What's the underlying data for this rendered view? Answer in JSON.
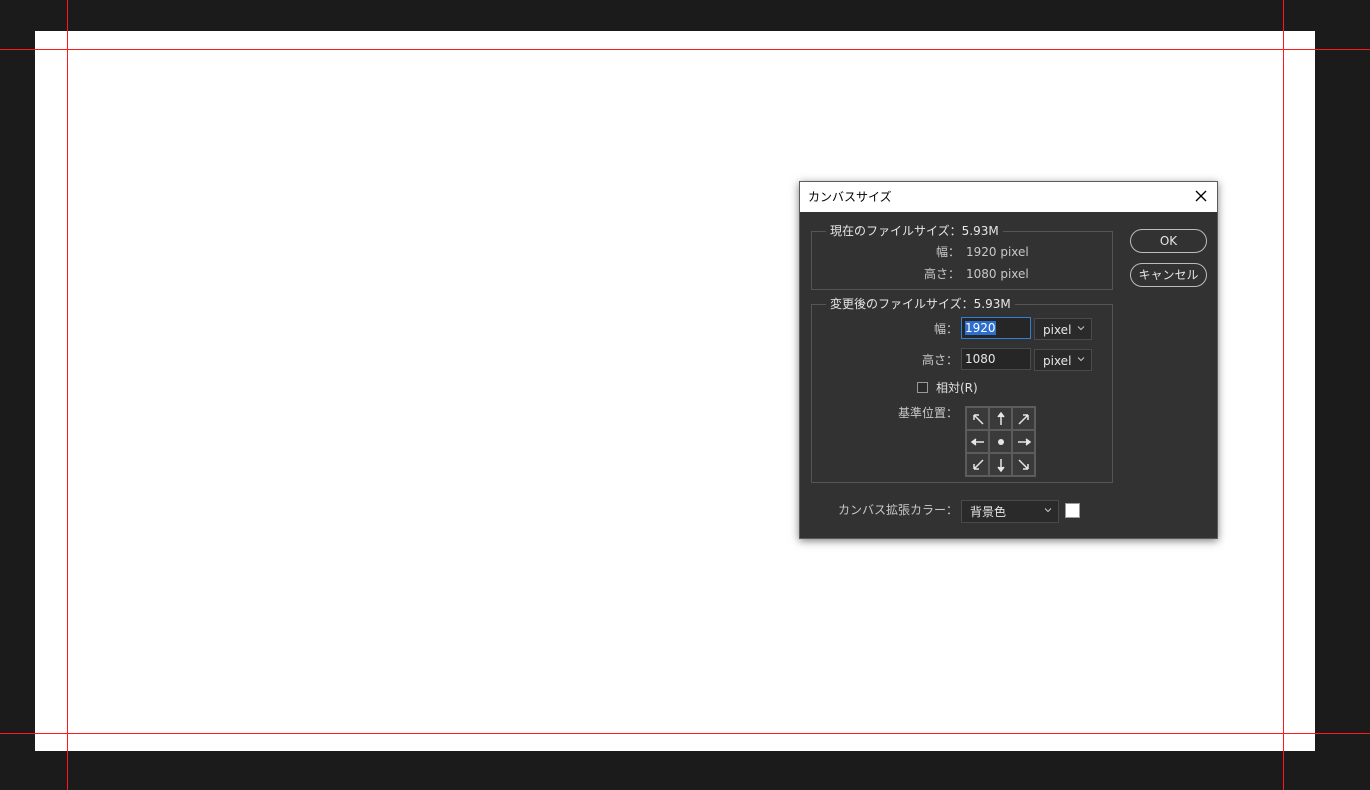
{
  "colors": {
    "workspace_bg": "#1b1b1b",
    "canvas_bg": "#ffffff",
    "guide": "#ff1a1a",
    "dialog_bg": "#323232",
    "selection": "#2d6fd1",
    "extension_swatch": "#ffffff"
  },
  "dialog": {
    "title": "カンバスサイズ",
    "close_icon": "close-icon",
    "current": {
      "legend": "現在のファイルサイズ：5.93M",
      "width_label": "幅：",
      "width_value": "1920 pixel",
      "height_label": "高さ：",
      "height_value": "1080 pixel"
    },
    "new": {
      "legend": "変更後のファイルサイズ：5.93M",
      "width_label": "幅：",
      "width_value": "1920",
      "width_unit": "pixel",
      "height_label": "高さ：",
      "height_value": "1080",
      "height_unit": "pixel",
      "relative_label": "相対(R)",
      "relative_checked": false,
      "anchor_label": "基準位置："
    },
    "extension_label": "カンバス拡張カラー：",
    "extension_value": "背景色",
    "ok_label": "OK",
    "cancel_label": "キャンセル"
  }
}
